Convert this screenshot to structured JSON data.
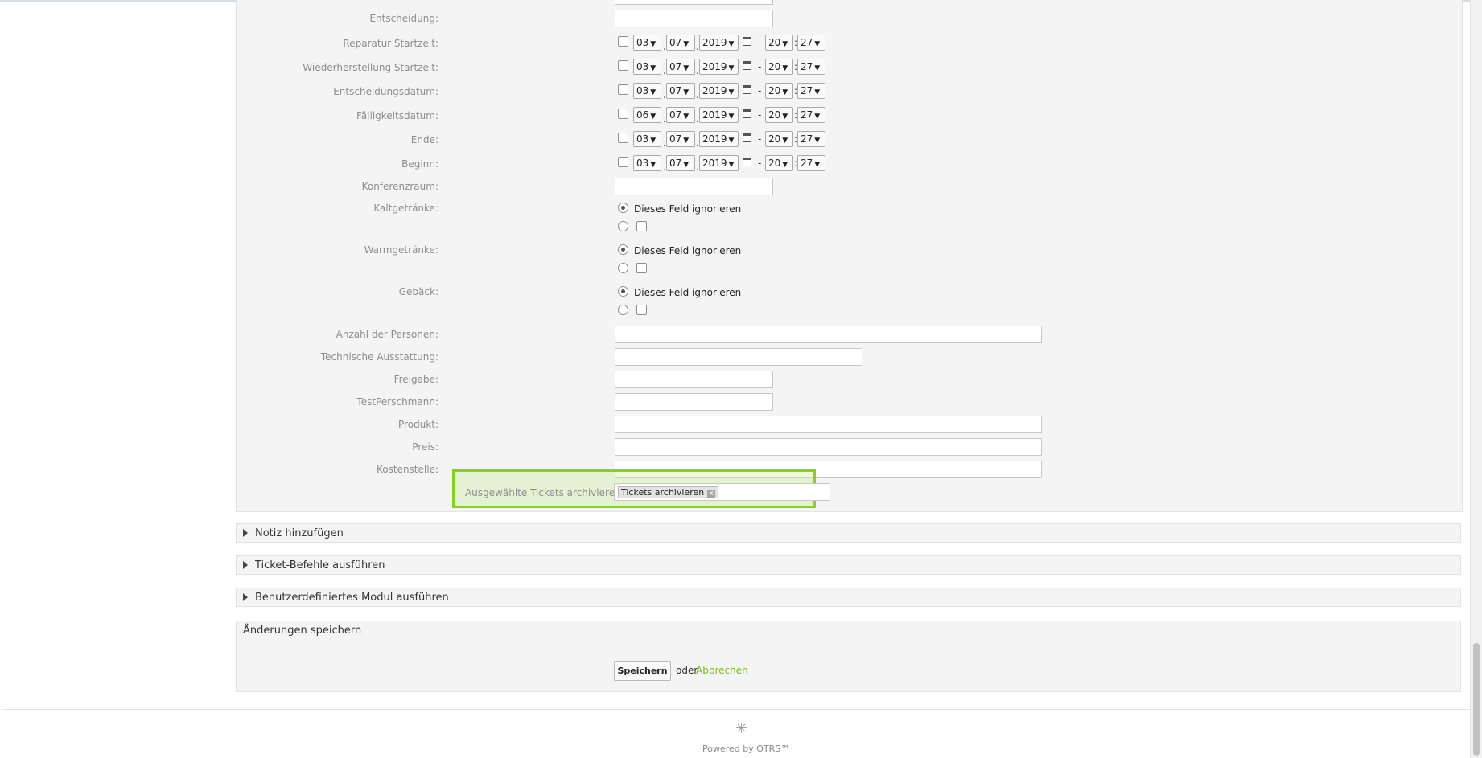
{
  "form": {
    "entscheidung_label": "Entscheidung:",
    "datetime_rows": [
      {
        "label": "Reparatur Startzeit:",
        "day": "03",
        "month": "07",
        "year": "2019",
        "hour": "20",
        "minute": "27"
      },
      {
        "label": "Wiederherstellung Startzeit:",
        "day": "03",
        "month": "07",
        "year": "2019",
        "hour": "20",
        "minute": "27"
      },
      {
        "label": "Entscheidungsdatum:",
        "day": "03",
        "month": "07",
        "year": "2019",
        "hour": "20",
        "minute": "27"
      },
      {
        "label": "Fälligkeitsdatum:",
        "day": "06",
        "month": "07",
        "year": "2019",
        "hour": "20",
        "minute": "27"
      },
      {
        "label": "Ende:",
        "day": "03",
        "month": "07",
        "year": "2019",
        "hour": "20",
        "minute": "27"
      },
      {
        "label": "Beginn:",
        "day": "03",
        "month": "07",
        "year": "2019",
        "hour": "20",
        "minute": "27"
      }
    ],
    "konferenzraum_label": "Konferenzraum:",
    "radio_groups": [
      {
        "label": "Kaltgetränke:",
        "ignore_text": "Dieses Feld ignorieren"
      },
      {
        "label": "Warmgetränke:",
        "ignore_text": "Dieses Feld ignorieren"
      },
      {
        "label": "Gebäck:",
        "ignore_text": "Dieses Feld ignorieren"
      }
    ],
    "text_fields": [
      {
        "label": "Anzahl der Personen:"
      },
      {
        "label": "Technische Ausstattung:"
      },
      {
        "label": "Freigabe:"
      },
      {
        "label": "TestPerschmann:"
      },
      {
        "label": "Produkt:"
      },
      {
        "label": "Preis:"
      },
      {
        "label": "Kostenstelle:"
      }
    ],
    "archive": {
      "label": "Ausgewählte Tickets archivieren:",
      "tag": "Tickets archivieren",
      "tag_remove": "x"
    },
    "separator_dash": "-",
    "separator_colon": ":",
    "separator_dot": "."
  },
  "sections": {
    "notiz": "Notiz hinzufügen",
    "befehle": "Ticket-Befehle ausführen",
    "modul": "Benutzerdefiniertes Modul ausführen",
    "save_heading": "Änderungen speichern"
  },
  "actions": {
    "save": "Speichern",
    "or": "oder",
    "cancel": "Abbrechen"
  },
  "footer": {
    "logo_glyph": "✳",
    "powered": "Powered by OTRS™"
  },
  "colors": {
    "highlight_border": "#86d21a",
    "link": "#7bbf18"
  }
}
